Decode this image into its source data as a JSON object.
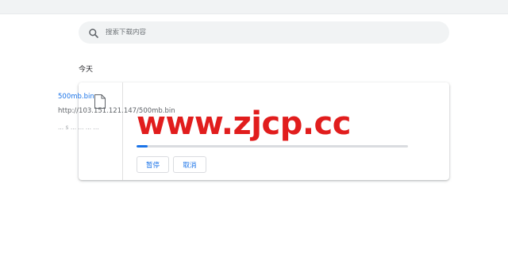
{
  "search": {
    "placeholder": "搜索下载内容",
    "icon": "search-icon"
  },
  "section": {
    "label": "今天"
  },
  "download": {
    "file_name": "500mb.bin",
    "url": "http://103.151.121.147/500mb.bin",
    "status_text": "... s ... ... ... ...",
    "progress": 0.04,
    "pause_label": "暂停",
    "cancel_label": "取消",
    "icon": "file-icon"
  },
  "watermark": {
    "text": "www.zjcp.cc"
  },
  "colors": {
    "accent": "#1a73e8",
    "watermark": "#e11d1d",
    "search_bg": "#f1f3f4"
  }
}
